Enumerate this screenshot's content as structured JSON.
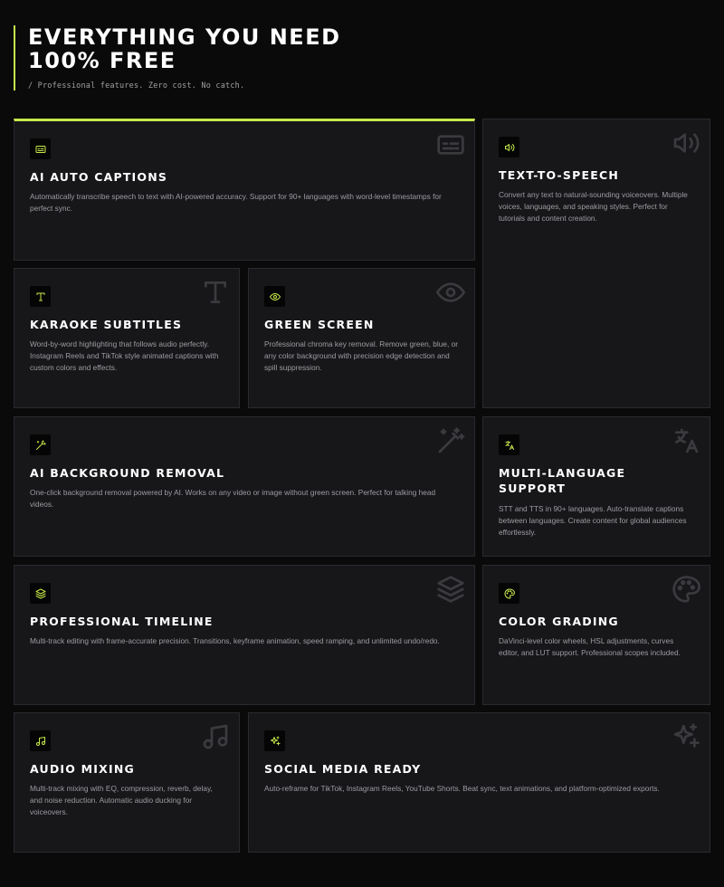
{
  "header": {
    "title_line1": "EVERYTHING YOU NEED",
    "title_line2": "100% FREE",
    "subtitle": "/ Professional features. Zero cost. No catch."
  },
  "colors": {
    "accent": "#c6e94b",
    "background": "#0a0a0b",
    "card": "#17171a",
    "card_border": "#2a2a2e"
  },
  "features": [
    {
      "icon": "captions-icon",
      "title": "AI AUTO CAPTIONS",
      "description": "Automatically transcribe speech to text with AI-powered accuracy. Support for 90+ languages with word-level timestamps for perfect sync."
    },
    {
      "icon": "speaker-icon",
      "title": "TEXT-TO-SPEECH",
      "description": "Convert any text to natural-sounding voiceovers. Multiple voices, languages, and speaking styles. Perfect for tutorials and content creation."
    },
    {
      "icon": "type-icon",
      "title": "KARAOKE SUBTITLES",
      "description": "Word-by-word highlighting that follows audio perfectly. Instagram Reels and TikTok style animated captions with custom colors and effects."
    },
    {
      "icon": "eye-icon",
      "title": "GREEN SCREEN",
      "description": "Professional chroma key removal. Remove green, blue, or any color background with precision edge detection and spill suppression."
    },
    {
      "icon": "magic-wand-icon",
      "title": "AI BACKGROUND REMOVAL",
      "description": "One-click background removal powered by AI. Works on any video or image without green screen. Perfect for talking head videos."
    },
    {
      "icon": "translate-icon",
      "title": "MULTI-LANGUAGE SUPPORT",
      "description": "STT and TTS in 90+ languages. Auto-translate captions between languages. Create content for global audiences effortlessly."
    },
    {
      "icon": "layers-icon",
      "title": "PROFESSIONAL TIMELINE",
      "description": "Multi-track editing with frame-accurate precision. Transitions, keyframe animation, speed ramping, and unlimited undo/redo."
    },
    {
      "icon": "palette-icon",
      "title": "COLOR GRADING",
      "description": "DaVinci-level color wheels, HSL adjustments, curves editor, and LUT support. Professional scopes included."
    },
    {
      "icon": "music-icon",
      "title": "AUDIO MIXING",
      "description": "Multi-track mixing with EQ, compression, reverb, delay, and noise reduction. Automatic audio ducking for voiceovers."
    },
    {
      "icon": "sparkles-icon",
      "title": "SOCIAL MEDIA READY",
      "description": "Auto-reframe for TikTok, Instagram Reels, YouTube Shorts. Beat sync, text animations, and platform-optimized exports."
    }
  ]
}
